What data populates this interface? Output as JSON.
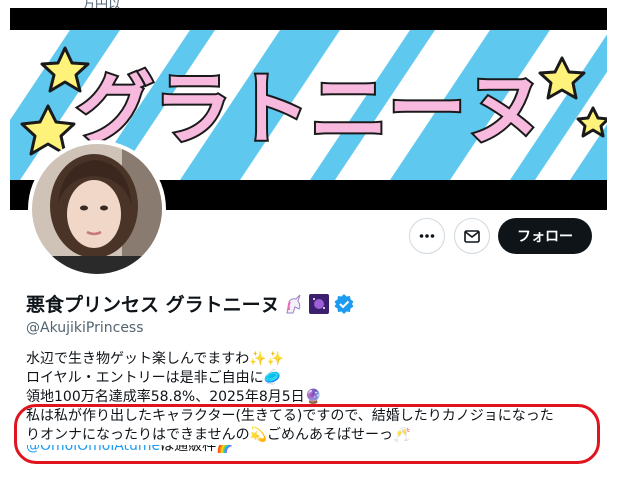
{
  "top_cut_text": "万円以",
  "banner": {
    "title": "グラトニーヌ",
    "colors": {
      "stripe": "#5ec8ee",
      "sky": "#ffffff",
      "title_fill": "#f7b9dd",
      "title_outline": "#1a1a1a",
      "star": "#fff27a"
    }
  },
  "actions": {
    "more_icon": "more-horizontal-icon",
    "message_icon": "envelope-icon",
    "follow_label": "フォロー"
  },
  "profile": {
    "display_name": "悪食プリンセス グラトニーヌ",
    "name_emojis": [
      "unicorn-emoji",
      "galaxy-emoji"
    ],
    "verified_icon": "verified-badge-icon",
    "handle": "@AkujikiPrincess"
  },
  "bio": {
    "line1": "水辺で生き物ゲット楽しんでますわ✨✨",
    "line2": "ロイヤル・エントリーは是非ご自由に🥏",
    "line3": "領地100万名達成率58.8%、2025年8月5日🔮",
    "line4": "私は私が作り出したキャラクター(生きてる)ですので、結婚したりカノジョになった",
    "line5": "りオンナになったりはできませんの💫ごめんあそばせーっ🥂",
    "line6_mention": "@OmoiOmoiAtume",
    "line6_text": "は通販枠🌈"
  },
  "annotation": {
    "color": "#e0141e"
  }
}
